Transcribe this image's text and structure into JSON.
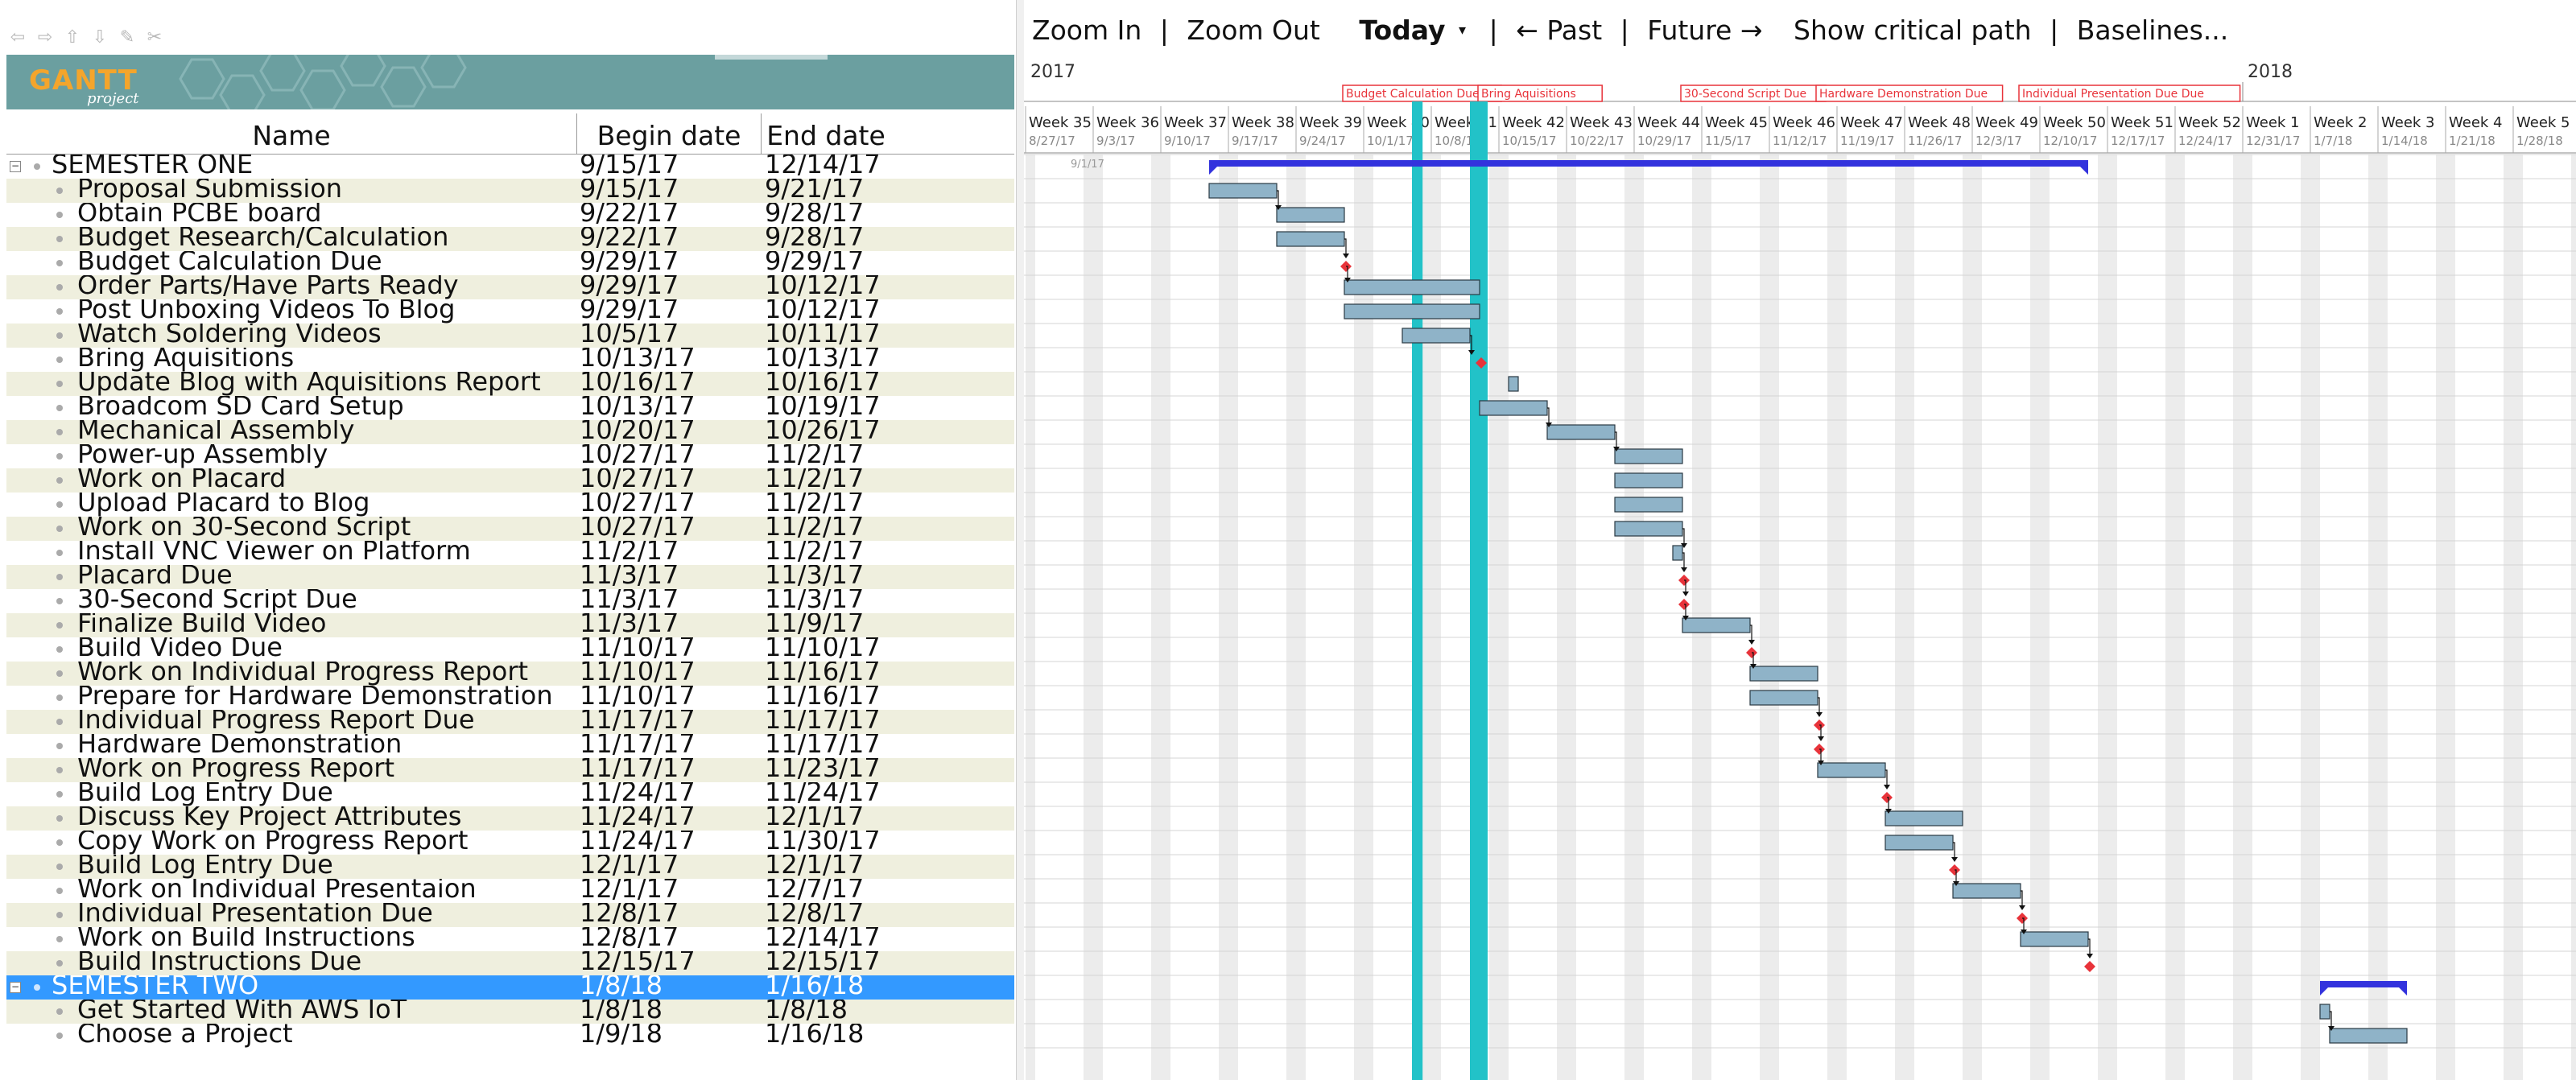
{
  "nav": {
    "icons": [
      "arrow-left-icon",
      "arrow-right-icon",
      "arrow-up-icon",
      "arrow-down-icon",
      "link-icon",
      "unlink-icon"
    ]
  },
  "banner": {
    "logo_text": "GANTT",
    "logo_sub": "project"
  },
  "columns": {
    "name": "Name",
    "begin": "Begin date",
    "end": "End date"
  },
  "tasks": [
    {
      "name": "SEMESTER ONE",
      "begin": "9/15/17",
      "end": "12/14/17",
      "level": 0
    },
    {
      "name": "Proposal Submission",
      "begin": "9/15/17",
      "end": "9/21/17",
      "level": 1
    },
    {
      "name": "Obtain PCBE board",
      "begin": "9/22/17",
      "end": "9/28/17",
      "level": 1
    },
    {
      "name": "Budget Research/Calculation",
      "begin": "9/22/17",
      "end": "9/28/17",
      "level": 1
    },
    {
      "name": "Budget Calculation Due",
      "begin": "9/29/17",
      "end": "9/29/17",
      "level": 1
    },
    {
      "name": "Order Parts/Have Parts Ready",
      "begin": "9/29/17",
      "end": "10/12/17",
      "level": 1
    },
    {
      "name": "Post Unboxing Videos To Blog",
      "begin": "9/29/17",
      "end": "10/12/17",
      "level": 1
    },
    {
      "name": "Watch Soldering Videos",
      "begin": "10/5/17",
      "end": "10/11/17",
      "level": 1
    },
    {
      "name": "Bring Aquisitions",
      "begin": "10/13/17",
      "end": "10/13/17",
      "level": 1
    },
    {
      "name": "Update Blog with Aquisitions Report",
      "begin": "10/16/17",
      "end": "10/16/17",
      "level": 1
    },
    {
      "name": "Broadcom SD Card Setup",
      "begin": "10/13/17",
      "end": "10/19/17",
      "level": 1
    },
    {
      "name": "Mechanical Assembly",
      "begin": "10/20/17",
      "end": "10/26/17",
      "level": 1
    },
    {
      "name": "Power-up Assembly",
      "begin": "10/27/17",
      "end": "11/2/17",
      "level": 1
    },
    {
      "name": "Work on Placard",
      "begin": "10/27/17",
      "end": "11/2/17",
      "level": 1
    },
    {
      "name": "Upload Placard to Blog",
      "begin": "10/27/17",
      "end": "11/2/17",
      "level": 1
    },
    {
      "name": "Work on 30-Second Script",
      "begin": "10/27/17",
      "end": "11/2/17",
      "level": 1
    },
    {
      "name": "Install VNC Viewer on Platform",
      "begin": "11/2/17",
      "end": "11/2/17",
      "level": 1
    },
    {
      "name": "Placard Due",
      "begin": "11/3/17",
      "end": "11/3/17",
      "level": 1
    },
    {
      "name": "30-Second Script Due",
      "begin": "11/3/17",
      "end": "11/3/17",
      "level": 1
    },
    {
      "name": "Finalize Build Video",
      "begin": "11/3/17",
      "end": "11/9/17",
      "level": 1
    },
    {
      "name": "Build Video Due",
      "begin": "11/10/17",
      "end": "11/10/17",
      "level": 1
    },
    {
      "name": "Work on Individual Progress Report",
      "begin": "11/10/17",
      "end": "11/16/17",
      "level": 1
    },
    {
      "name": "Prepare for Hardware Demonstration",
      "begin": "11/10/17",
      "end": "11/16/17",
      "level": 1
    },
    {
      "name": "Individual Progress Report Due",
      "begin": "11/17/17",
      "end": "11/17/17",
      "level": 1
    },
    {
      "name": "Hardware Demonstration",
      "begin": "11/17/17",
      "end": "11/17/17",
      "level": 1
    },
    {
      "name": "Work on Progress Report",
      "begin": "11/17/17",
      "end": "11/23/17",
      "level": 1
    },
    {
      "name": "Build Log Entry Due",
      "begin": "11/24/17",
      "end": "11/24/17",
      "level": 1
    },
    {
      "name": "Discuss Key Project Attributes",
      "begin": "11/24/17",
      "end": "12/1/17",
      "level": 1
    },
    {
      "name": "Copy Work on Progress Report",
      "begin": "11/24/17",
      "end": "11/30/17",
      "level": 1
    },
    {
      "name": "Build Log Entry Due",
      "begin": "12/1/17",
      "end": "12/1/17",
      "level": 1
    },
    {
      "name": "Work on Individual Presentaion",
      "begin": "12/1/17",
      "end": "12/7/17",
      "level": 1
    },
    {
      "name": "Individual Presentation Due",
      "begin": "12/8/17",
      "end": "12/8/17",
      "level": 1
    },
    {
      "name": "Work on Build Instructions",
      "begin": "12/8/17",
      "end": "12/14/17",
      "level": 1
    },
    {
      "name": "Build Instructions Due",
      "begin": "12/15/17",
      "end": "12/15/17",
      "level": 1
    },
    {
      "name": "SEMESTER TWO",
      "begin": "1/8/18",
      "end": "1/16/18",
      "level": 0,
      "selected": true
    },
    {
      "name": "Get Started With AWS IoT",
      "begin": "1/8/18",
      "end": "1/8/18",
      "level": 1
    },
    {
      "name": "Choose a Project",
      "begin": "1/9/18",
      "end": "1/16/18",
      "level": 1
    }
  ],
  "toolbar": {
    "zoom_in": "Zoom In",
    "zoom_out": "Zoom Out",
    "today": "Today",
    "past": "← Past",
    "future": "Future →",
    "critical": "Show critical path",
    "baselines": "Baselines..."
  },
  "timeline": {
    "years": [
      {
        "label": "2017",
        "week_index": 0
      },
      {
        "label": "2018",
        "week_index": 18
      }
    ],
    "weeks": [
      {
        "label": "Week 35",
        "date": "8/27/17"
      },
      {
        "label": "Week 36",
        "date": "9/3/17"
      },
      {
        "label": "Week 37",
        "date": "9/10/17"
      },
      {
        "label": "Week 38",
        "date": "9/17/17"
      },
      {
        "label": "Week 39",
        "date": "9/24/17"
      },
      {
        "label": "Week 40",
        "date": "10/1/17"
      },
      {
        "label": "Week 41",
        "date": "10/8/17"
      },
      {
        "label": "Week 42",
        "date": "10/15/17"
      },
      {
        "label": "Week 43",
        "date": "10/22/17"
      },
      {
        "label": "Week 44",
        "date": "10/29/17"
      },
      {
        "label": "Week 45",
        "date": "11/5/17"
      },
      {
        "label": "Week 46",
        "date": "11/12/17"
      },
      {
        "label": "Week 47",
        "date": "11/19/17"
      },
      {
        "label": "Week 48",
        "date": "11/26/17"
      },
      {
        "label": "Week 49",
        "date": "12/3/17"
      },
      {
        "label": "Week 50",
        "date": "12/10/17"
      },
      {
        "label": "Week 51",
        "date": "12/17/17"
      },
      {
        "label": "Week 52",
        "date": "12/24/17"
      },
      {
        "label": "Week 1",
        "date": "12/31/17"
      },
      {
        "label": "Week 2",
        "date": "1/7/18"
      },
      {
        "label": "Week 3",
        "date": "1/14/18"
      },
      {
        "label": "Week 4",
        "date": "1/21/18"
      },
      {
        "label": "Week 5",
        "date": "1/28/18"
      }
    ],
    "start_marker": "9/1/17",
    "today_dates": [
      "10/6/17",
      "10/12/17"
    ],
    "milestone_labels": [
      {
        "text": "Budget Calculation Due",
        "date": "9/29/17"
      },
      {
        "text": "Bring Aquisitions",
        "date": "10/13/17"
      },
      {
        "text": "30-Second Script Due",
        "date": "11/3/17"
      },
      {
        "text": "Hardware Demonstration Due",
        "date": "11/17/17"
      },
      {
        "text": "Individual Presentation Due Due",
        "date": "12/8/17"
      }
    ],
    "colors": {
      "bar": "#8fb3c8",
      "bar_border": "#2b3a44",
      "summary": "#3333dd",
      "milestone": "#e8333a",
      "today": "#22c2c8",
      "weekend": "#ececec",
      "label_border": "#e8333a"
    }
  }
}
